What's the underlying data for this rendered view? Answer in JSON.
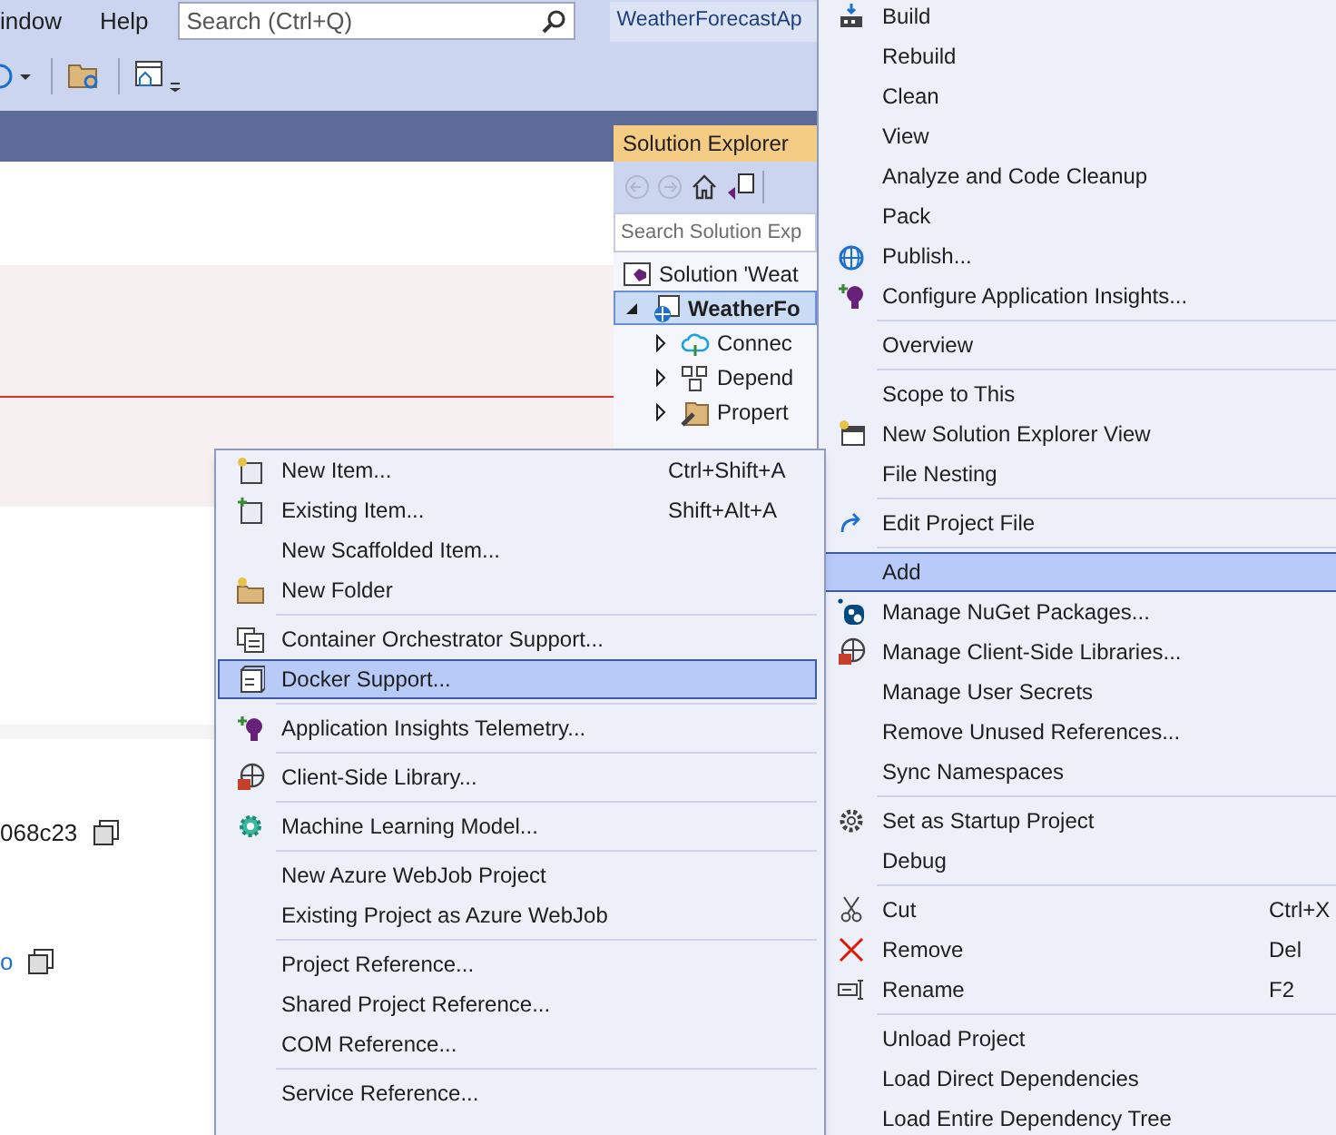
{
  "menubar": {
    "items": [
      "indow",
      "Help"
    ],
    "search": {
      "placeholder": "Search (Ctrl+Q)"
    },
    "solution_name": "WeatherForecastAp"
  },
  "editor": {
    "rows": [
      {
        "text": "068c23",
        "link": false
      },
      {
        "text": "o",
        "link": true
      }
    ]
  },
  "solution_explorer": {
    "title": "Solution Explorer",
    "search": {
      "placeholder": "Search Solution Exp"
    },
    "tree": [
      {
        "label": "Solution 'Weat",
        "selected": false,
        "children": [
          {
            "label": "WeatherFo",
            "selected": true,
            "expanded": true,
            "children": [
              {
                "label": "Connec",
                "selected": false,
                "expanded": false
              },
              {
                "label": "Depend",
                "selected": false,
                "expanded": false
              },
              {
                "label": "Propert",
                "selected": false,
                "expanded": false
              }
            ]
          }
        ]
      }
    ]
  },
  "context_menu": {
    "items": [
      {
        "kind": "item",
        "label": "Build",
        "selected": false
      },
      {
        "kind": "item",
        "label": "Rebuild",
        "selected": false
      },
      {
        "kind": "item",
        "label": "Clean",
        "selected": false
      },
      {
        "kind": "item",
        "label": "View",
        "selected": false
      },
      {
        "kind": "item",
        "label": "Analyze and Code Cleanup",
        "selected": false
      },
      {
        "kind": "item",
        "label": "Pack",
        "selected": false
      },
      {
        "kind": "item",
        "label": "Publish...",
        "selected": false
      },
      {
        "kind": "item",
        "label": "Configure Application Insights...",
        "selected": false
      },
      {
        "kind": "separator"
      },
      {
        "kind": "item",
        "label": "Overview",
        "selected": false
      },
      {
        "kind": "separator"
      },
      {
        "kind": "item",
        "label": "Scope to This",
        "selected": false
      },
      {
        "kind": "item",
        "label": "New Solution Explorer View",
        "selected": false
      },
      {
        "kind": "item",
        "label": "File Nesting",
        "selected": false
      },
      {
        "kind": "separator"
      },
      {
        "kind": "item",
        "label": "Edit Project File",
        "selected": false
      },
      {
        "kind": "separator"
      },
      {
        "kind": "item",
        "label": "Add",
        "selected": true
      },
      {
        "kind": "item",
        "label": "Manage NuGet Packages...",
        "selected": false
      },
      {
        "kind": "item",
        "label": "Manage Client-Side Libraries...",
        "selected": false
      },
      {
        "kind": "item",
        "label": "Manage User Secrets",
        "selected": false
      },
      {
        "kind": "item",
        "label": "Remove Unused References...",
        "selected": false
      },
      {
        "kind": "item",
        "label": "Sync Namespaces",
        "selected": false
      },
      {
        "kind": "separator"
      },
      {
        "kind": "item",
        "label": "Set as Startup Project",
        "selected": false
      },
      {
        "kind": "item",
        "label": "Debug",
        "selected": false
      },
      {
        "kind": "separator"
      },
      {
        "kind": "item",
        "label": "Cut",
        "shortcut": "Ctrl+X",
        "selected": false
      },
      {
        "kind": "item",
        "label": "Remove",
        "shortcut": "Del",
        "selected": false
      },
      {
        "kind": "item",
        "label": "Rename",
        "shortcut": "F2",
        "selected": false
      },
      {
        "kind": "separator"
      },
      {
        "kind": "item",
        "label": "Unload Project",
        "selected": false
      },
      {
        "kind": "item",
        "label": "Load Direct Dependencies",
        "selected": false
      },
      {
        "kind": "item",
        "label": "Load Entire Dependency Tree",
        "selected": false
      }
    ]
  },
  "add_submenu": {
    "items": [
      {
        "kind": "item",
        "label": "New Item...",
        "shortcut": "Ctrl+Shift+A",
        "selected": false
      },
      {
        "kind": "item",
        "label": "Existing Item...",
        "shortcut": "Shift+Alt+A",
        "selected": false
      },
      {
        "kind": "item",
        "label": "New Scaffolded Item...",
        "selected": false
      },
      {
        "kind": "item",
        "label": "New Folder",
        "selected": false
      },
      {
        "kind": "separator"
      },
      {
        "kind": "item",
        "label": "Container Orchestrator Support...",
        "selected": false
      },
      {
        "kind": "item",
        "label": "Docker Support...",
        "selected": true
      },
      {
        "kind": "separator"
      },
      {
        "kind": "item",
        "label": "Application Insights Telemetry...",
        "selected": false
      },
      {
        "kind": "separator"
      },
      {
        "kind": "item",
        "label": "Client-Side Library...",
        "selected": false
      },
      {
        "kind": "separator"
      },
      {
        "kind": "item",
        "label": "Machine Learning Model...",
        "selected": false
      },
      {
        "kind": "separator"
      },
      {
        "kind": "item",
        "label": "New Azure WebJob Project",
        "selected": false
      },
      {
        "kind": "item",
        "label": "Existing Project as Azure WebJob",
        "selected": false
      },
      {
        "kind": "separator"
      },
      {
        "kind": "item",
        "label": "Project Reference...",
        "selected": false
      },
      {
        "kind": "item",
        "label": "Shared Project Reference...",
        "selected": false
      },
      {
        "kind": "item",
        "label": "COM Reference...",
        "selected": false
      },
      {
        "kind": "separator"
      },
      {
        "kind": "item",
        "label": "Service Reference...",
        "selected": false
      }
    ]
  }
}
